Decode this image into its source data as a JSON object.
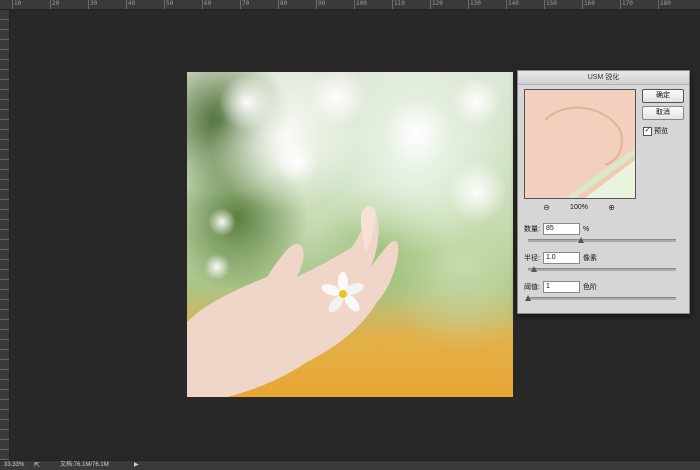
{
  "ruler": {
    "top_ticks": [
      "10",
      "20",
      "30",
      "40",
      "50",
      "60",
      "70",
      "80",
      "90",
      "100",
      "110",
      "120",
      "130",
      "140",
      "150",
      "160",
      "170",
      "180"
    ]
  },
  "dialog": {
    "title": "USM 锐化",
    "ok_label": "确定",
    "cancel_label": "取消",
    "preview_label": "预览",
    "preview_checked": true,
    "zoom_level": "100%",
    "amount": {
      "label": "数量:",
      "value": "85",
      "unit": "%",
      "slider_fraction": 0.36
    },
    "radius": {
      "label": "半径:",
      "value": "1.0",
      "unit": "像素",
      "slider_fraction": 0.04
    },
    "threshold": {
      "label": "阈值:",
      "value": "1",
      "unit": "色阶",
      "slider_fraction": 0.0
    }
  },
  "status": {
    "zoom": "33.33%",
    "doc_info": "文档:76.1M/76.1M"
  },
  "icons": {
    "zoom_out": "zoom-out-icon",
    "zoom_in": "zoom-in-icon",
    "play": "play-icon",
    "share": "share-icon"
  }
}
